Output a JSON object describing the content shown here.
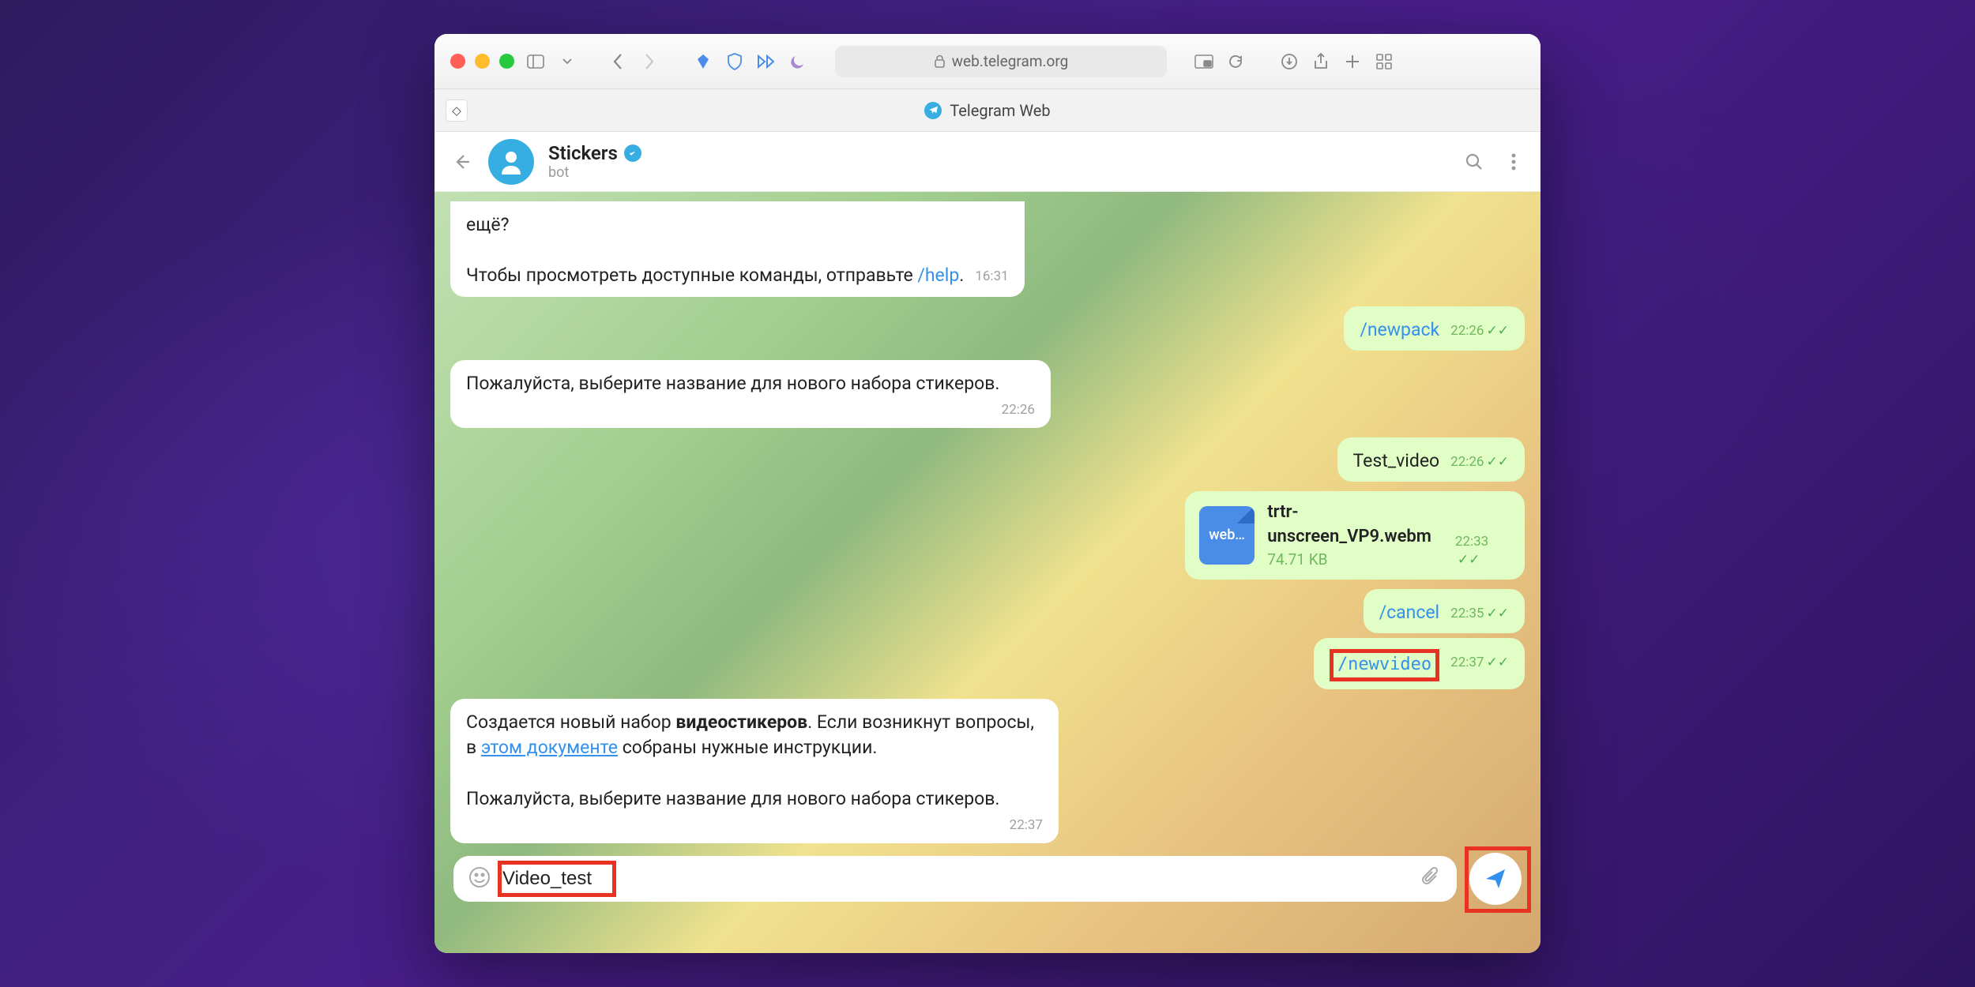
{
  "browser": {
    "url": "web.telegram.org",
    "tab_title": "Telegram Web"
  },
  "chat": {
    "title": "Stickers",
    "subtitle": "bot"
  },
  "messages": {
    "m1_part1": "ещё?",
    "m1_part2": "Чтобы просмотреть доступные команды, отправьте ",
    "m1_cmd": "/help",
    "m1_time": "16:31",
    "m2_cmd": "/newpack",
    "m2_time": "22:26",
    "m3_text": "Пожалуйста, выберите название для нового набора стикеров.",
    "m3_time": "22:26",
    "m4_text": "Test_video",
    "m4_time": "22:26",
    "m5_filename": "trtr-unscreen_VP9.webm",
    "m5_filesize": "74.71 KB",
    "m5_ext": "web…",
    "m5_time": "22:33",
    "m6_cmd": "/cancel",
    "m6_time": "22:35",
    "m7_cmd": "/newvideo",
    "m7_time": "22:37",
    "m8_p1a": "Создается новый набор ",
    "m8_p1b": "видеостикеров",
    "m8_p1c": ". Если возникнут вопросы, в ",
    "m8_link": "этом документе",
    "m8_p1d": " собраны нужные инструкции.",
    "m8_p2": "Пожалуйста, выберите название для нового набора стикеров.",
    "m8_time": "22:37"
  },
  "composer": {
    "value": "Video_test"
  }
}
